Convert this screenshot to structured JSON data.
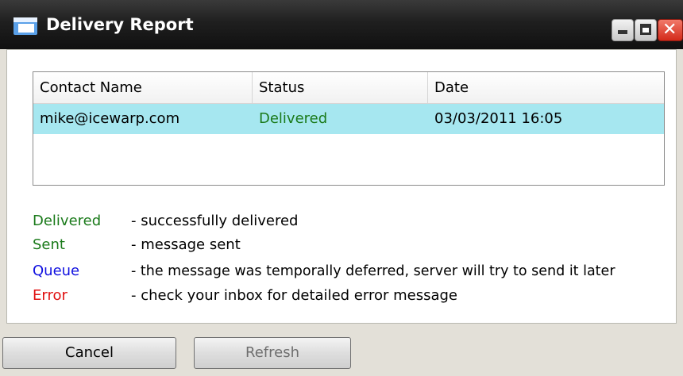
{
  "window": {
    "title": "Delivery Report",
    "close_glyph": "✕"
  },
  "table": {
    "columns": [
      "Contact Name",
      "Status",
      "Date"
    ],
    "rows": [
      {
        "contact": "mike@icewarp.com",
        "status": "Delivered",
        "date": "03/03/2011 16:05"
      }
    ]
  },
  "legend": [
    {
      "status": "Delivered",
      "description": "- successfully delivered",
      "color": "#1a7a1a"
    },
    {
      "status": "Sent",
      "description": "- message sent",
      "color": "#1a7a1a"
    },
    {
      "status": "Queue",
      "description": "- the message was temporally deferred, server will try to send it later",
      "color": "#1010e0"
    },
    {
      "status": "Error",
      "description": "- check your inbox for detailed error message",
      "color": "#e01010"
    }
  ],
  "buttons": {
    "cancel": "Cancel",
    "refresh": "Refresh"
  },
  "colors": {
    "selected_row": "#a6e7f0",
    "delivered": "#1a7a1a"
  }
}
